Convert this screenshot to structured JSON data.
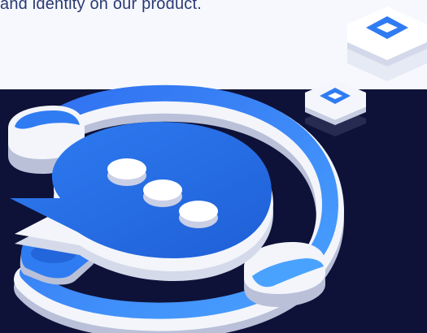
{
  "header": {
    "tagline": "and identity on our product."
  },
  "illustration": {
    "subject": "chat-bubble-with-headset",
    "colors": {
      "background_dark": "#0e1238",
      "background_light": "#f6f8fd",
      "accent_blue": "#2f7cf2",
      "accent_blue_light": "#4aa2ff",
      "accent_blue_dark": "#1c56c9",
      "surface_white": "#f3f5fb",
      "surface_shadow": "#b9c0d8",
      "text_dark": "#2a3a73"
    }
  }
}
